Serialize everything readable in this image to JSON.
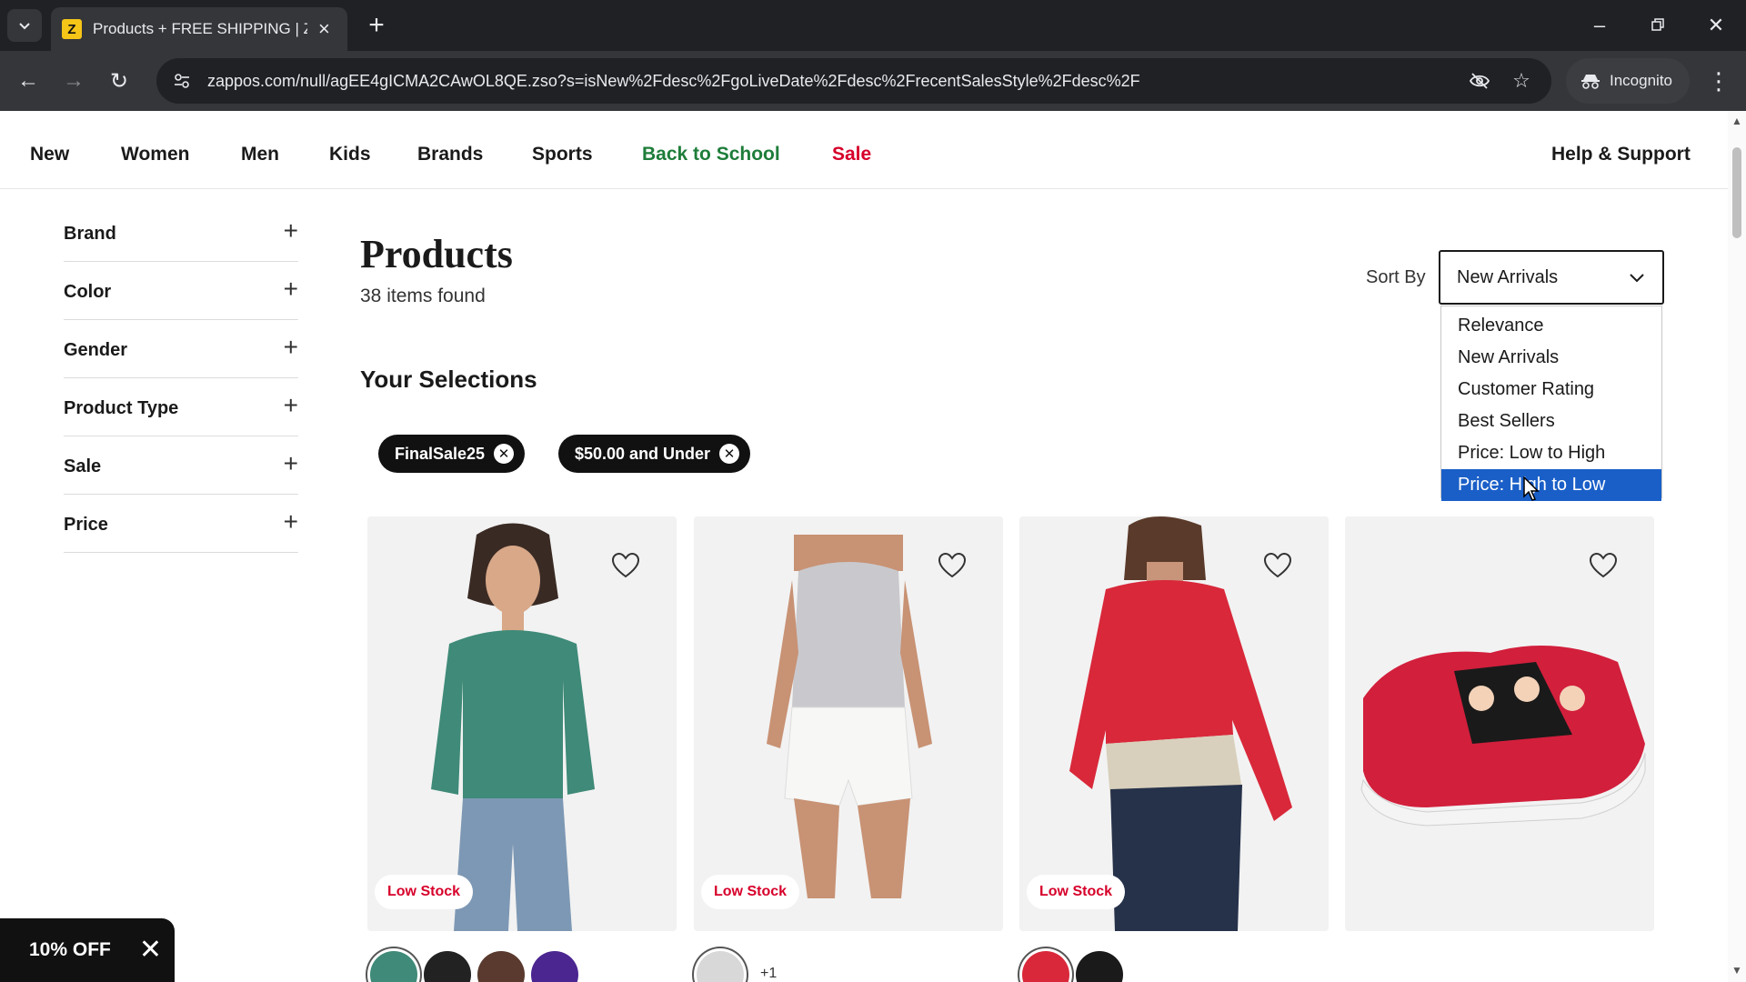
{
  "browser": {
    "tab_title": "Products + FREE SHIPPING | Za",
    "favicon_letter": "Z",
    "url": "zappos.com/null/agEE4gICMA2CAwOL8QE.zso?s=isNew%2Fdesc%2FgoLiveDate%2Fdesc%2FrecentSalesStyle%2Fdesc%2F",
    "incognito_label": "Incognito"
  },
  "nav": {
    "items": [
      "New",
      "Women",
      "Men",
      "Kids",
      "Brands",
      "Sports",
      "Back to School",
      "Sale"
    ],
    "help": "Help & Support"
  },
  "filters": [
    "Brand",
    "Color",
    "Gender",
    "Product Type",
    "Sale",
    "Price"
  ],
  "main": {
    "title": "Products",
    "count": "38 items found",
    "selections_title": "Your Selections",
    "chips": [
      "FinalSale25",
      "$50.00 and Under"
    ]
  },
  "sort": {
    "label": "Sort By",
    "selected": "New Arrivals",
    "options": [
      "Relevance",
      "New Arrivals",
      "Customer Rating",
      "Best Sellers",
      "Price: Low to High",
      "Price: High to Low"
    ],
    "highlighted": "Price: High to Low"
  },
  "products": [
    {
      "badge": "Low Stock",
      "swatches": [
        "#3f8a78",
        "#222222",
        "#5a3a2e",
        "#4b2590"
      ]
    },
    {
      "badge": "Low Stock",
      "swatches": [
        "#d8d8d8"
      ],
      "more": "+1"
    },
    {
      "badge": "Low Stock",
      "swatches": [
        "#d9283a",
        "#1a1a1a"
      ]
    },
    {
      "badge": "",
      "swatches": []
    }
  ],
  "promo": {
    "label": "10% OFF"
  },
  "colors": {
    "accent_green": "#1e7d3a",
    "sale_red": "#d7002a",
    "highlight_blue": "#1a5fc8"
  }
}
